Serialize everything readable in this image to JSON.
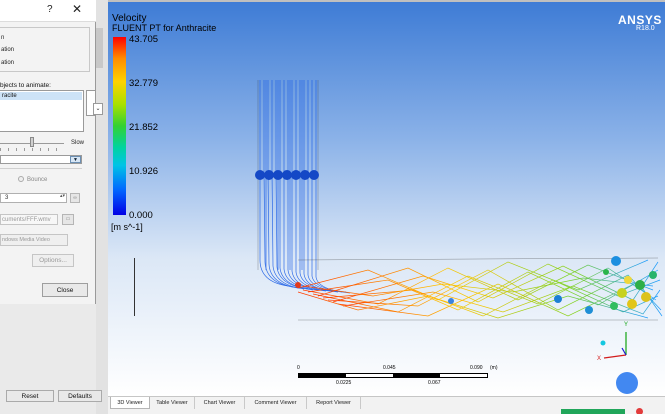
{
  "dialog": {
    "help_glyph": "?",
    "close_glyph": "✕",
    "options": [
      "n",
      "ation",
      "ation"
    ],
    "objects_label": "bjects to animate:",
    "selected_item": "racite",
    "scroll_glyph": "⌄",
    "slider_slow": "Slow",
    "combo_glyph": "▼",
    "bounce_label": "Bounce",
    "repeat_value": "3",
    "spin_glyph": "▴▾",
    "infinity_glyph": "∞",
    "path_value": "cuments/FFF.wmv",
    "browse_glyph": "📁",
    "format_value": "ndows Media Video",
    "options_button": "Options...",
    "close_button": "Close"
  },
  "panel": {
    "reset_button": "Reset",
    "defaults_button": "Defaults"
  },
  "viewer": {
    "legend_title": "Velocity",
    "legend_subtitle": "FLUENT PT for Anthracite",
    "legend_values": [
      "43.705",
      "32.779",
      "21.852",
      "10.926",
      "0.000"
    ],
    "legend_unit": "[m s^-1]",
    "logo": "ANSYS",
    "version": "R18.0",
    "scale_top": [
      "0",
      "0.045",
      "0.090",
      "(m)"
    ],
    "scale_bottom": [
      "0.0225",
      "0.067"
    ],
    "axis_y": "Y",
    "axis_x": "X",
    "axis_z": "Z",
    "colors": {
      "bg_top": "#3d7bd5",
      "bg_bottom": "#ffffff",
      "logo": "#ffffff"
    }
  },
  "tabs": [
    {
      "label": "3D Viewer",
      "active": true
    },
    {
      "label": "Table Viewer",
      "active": false
    },
    {
      "label": "Chart Viewer",
      "active": false
    },
    {
      "label": "Comment Viewer",
      "active": false
    },
    {
      "label": "Report Viewer",
      "active": false
    }
  ]
}
